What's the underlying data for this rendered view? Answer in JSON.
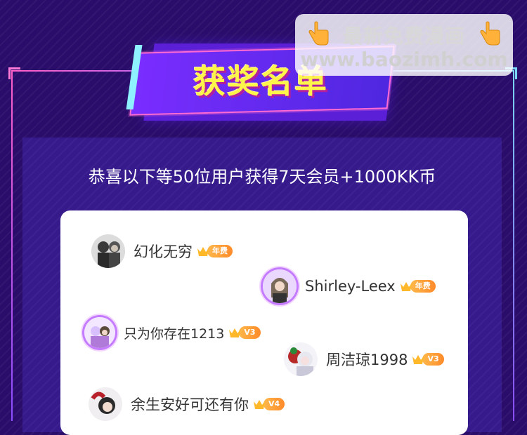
{
  "header": {
    "title": "获奖名单"
  },
  "subtitle": "恭喜以下等50位用户获得7天会员+1000KK币",
  "winners": [
    {
      "name": "幻化无穷",
      "badge": "年费"
    },
    {
      "name": "Shirley-Leex",
      "badge": "年费"
    },
    {
      "name": "只为你存在1213",
      "badge": "V3"
    },
    {
      "name": "周洁琼1998",
      "badge": "V3"
    },
    {
      "name": "余生安好可还有你",
      "badge": "V4"
    }
  ],
  "watermark": {
    "line1": "最新免费漫画",
    "line2": "www.baozimh.com"
  },
  "colors": {
    "background": "#2a0d6b",
    "title_yellow": "#fff44a",
    "badge_orange": "#ff9a2a",
    "frame_pink": "#ff5fc8"
  },
  "icons": {
    "crown": "crown-icon",
    "hand": "pointing-hand-icon"
  }
}
